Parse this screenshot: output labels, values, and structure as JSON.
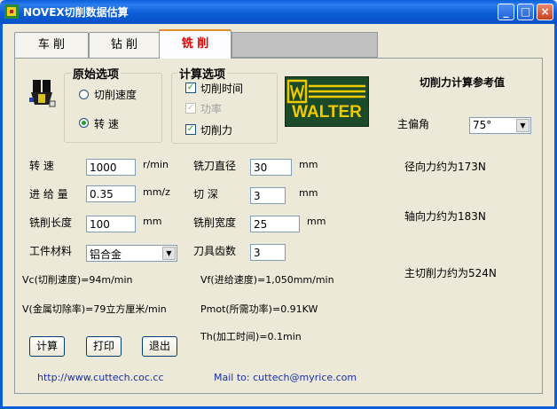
{
  "window": {
    "title": "NOVEX切削数据估算"
  },
  "tabs": {
    "turning": "车  削",
    "drilling": "钻  削",
    "milling": "铣  削"
  },
  "original": {
    "title": "原始选项",
    "cutting_speed": "切削速度",
    "spindle_speed": "转      速",
    "selected": "spindle_speed"
  },
  "calc": {
    "title": "计算选项",
    "cutting_time": "切削时间",
    "power": "功率",
    "cutting_force": "切削力"
  },
  "logo": {
    "text": "WALTER",
    "color": "#f0c800",
    "bg": "#1a4a28"
  },
  "ref": {
    "title": "切削力计算参考值",
    "lead_angle_label": "主偏角",
    "lead_angle_value": "75°",
    "radial_force": "径向力约为173N",
    "axial_force": "轴向力约为183N",
    "main_force": "主切削力约为524N"
  },
  "params": {
    "speed": {
      "label": "转    速",
      "value": "1000",
      "unit": "r/min"
    },
    "feed": {
      "label": "进 给 量",
      "value": "0.35",
      "unit": "mm/z"
    },
    "length": {
      "label": "铣削长度",
      "value": "100",
      "unit": "mm"
    },
    "material": {
      "label": "工件材料",
      "value": "铝合金"
    },
    "diameter": {
      "label": "铣刀直径",
      "value": "30",
      "unit": "mm"
    },
    "depth": {
      "label": "切    深",
      "value": "3",
      "unit": "mm"
    },
    "width": {
      "label": "铣削宽度",
      "value": "25",
      "unit": "mm"
    },
    "teeth": {
      "label": "刀具齿数",
      "value": "3"
    }
  },
  "results": {
    "vc": "Vc(切削速度)=94m/min",
    "vf": "Vf(进给速度)=1,050mm/min",
    "v": "V(金属切除率)=79立方厘米/min",
    "pmot": "Pmot(所需功率)=0.91KW",
    "th": "Th(加工时间)=0.1min"
  },
  "buttons": {
    "calculate": "计算",
    "print": "打印",
    "exit": "退出"
  },
  "footer": {
    "website": "http://www.cuttech.coc.cc",
    "mail": "Mail to: cuttech@myrice.com"
  }
}
